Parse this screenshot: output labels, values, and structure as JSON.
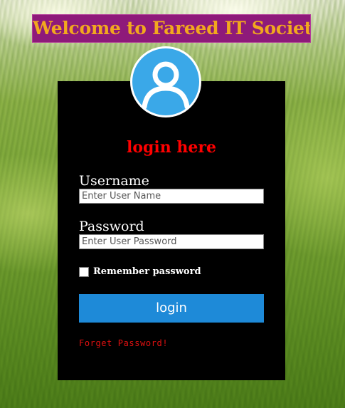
{
  "banner": {
    "title": "Welcome to Fareed IT Society"
  },
  "avatar": {
    "icon": "user-avatar-icon",
    "color": "#3aa8e8"
  },
  "form": {
    "heading": "login here",
    "username": {
      "label": "Username",
      "placeholder": "Enter User Name",
      "value": ""
    },
    "password": {
      "label": "Password",
      "placeholder": "Enter User Password",
      "value": ""
    },
    "remember": {
      "label": "Remember password",
      "checked": false
    },
    "submit_label": "login",
    "forgot_label": "Forget Password!"
  },
  "colors": {
    "banner_bg": "#8e1a7a",
    "banner_text": "#f2a81e",
    "panel_bg": "#000000",
    "heading": "#ff0000",
    "button": "#1e8ad8",
    "forgot_link": "#e01010"
  }
}
